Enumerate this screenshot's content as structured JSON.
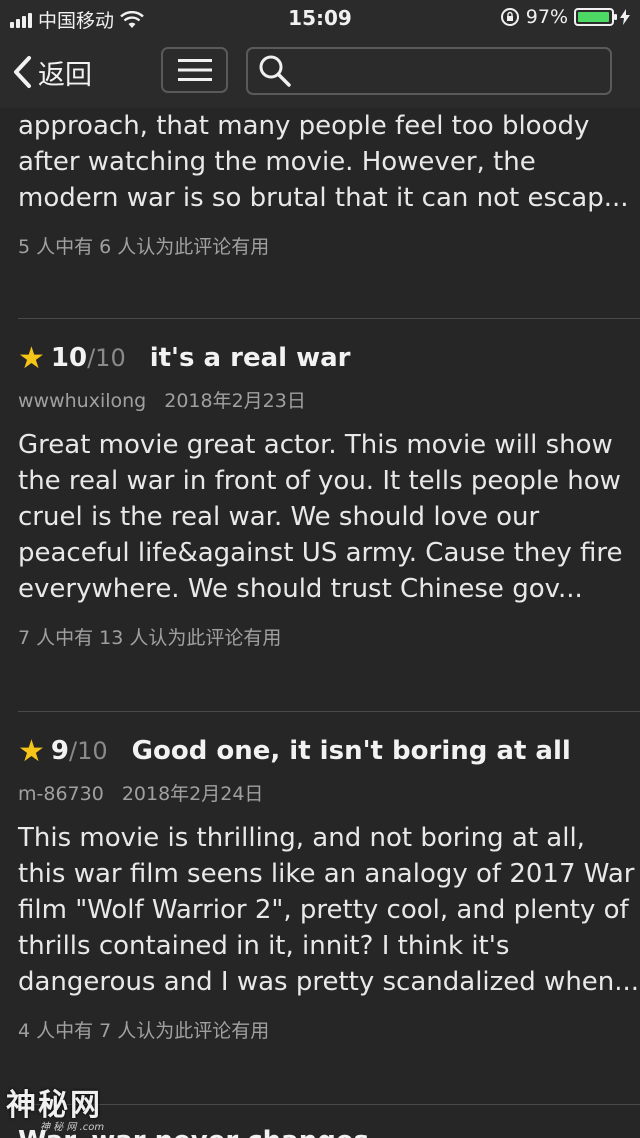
{
  "status_bar": {
    "carrier": "中国移动",
    "time": "15:09",
    "battery_percent": "97%",
    "battery_level": 0.97
  },
  "nav": {
    "back_label": "返回",
    "menu_icon": "hamburger-menu-icon",
    "search_icon": "search-icon",
    "search_value": ""
  },
  "partial_review": {
    "body_lines": [
      "approach, that many people feel too bloody",
      "after watching the movie. However, the",
      "modern war is so brutal that it can not escap..."
    ],
    "helpful": "5 人中有 6 人认为此评论有用"
  },
  "reviews": [
    {
      "score": "10",
      "out_of": "/10",
      "title": "it's a real war",
      "author": "wwwhuxilong",
      "date": "2018年2月23日",
      "body_lines": [
        "Great movie great actor. This movie will show",
        "the real war in front of you. It tells people how",
        "cruel is the real war. We should love our",
        "peaceful life&against US army. Cause they fire",
        "everywhere. We should trust Chinese gov..."
      ],
      "helpful": "7 人中有 13 人认为此评论有用"
    },
    {
      "score": "9",
      "out_of": "/10",
      "title": "Good one, it isn't boring at all",
      "author": "m-86730",
      "date": "2018年2月24日",
      "body_lines": [
        "This movie is thrilling, and not boring at all,",
        "this war film seens like an analogy of 2017 War",
        "film \"Wolf Warrior 2\", pretty cool, and plenty of",
        "thrills contained in it, innit? I think it's",
        "dangerous and I was pretty scandalized when..."
      ],
      "helpful": "4 人中有 7 人认为此评论有用"
    }
  ],
  "next_review_title_cut": "War, war never changes",
  "watermark": "神秘网",
  "watermark_sub": "神 秘 网 .com",
  "colors": {
    "star": "#f5c518",
    "battery": "#4cd964",
    "background": "#262626"
  }
}
